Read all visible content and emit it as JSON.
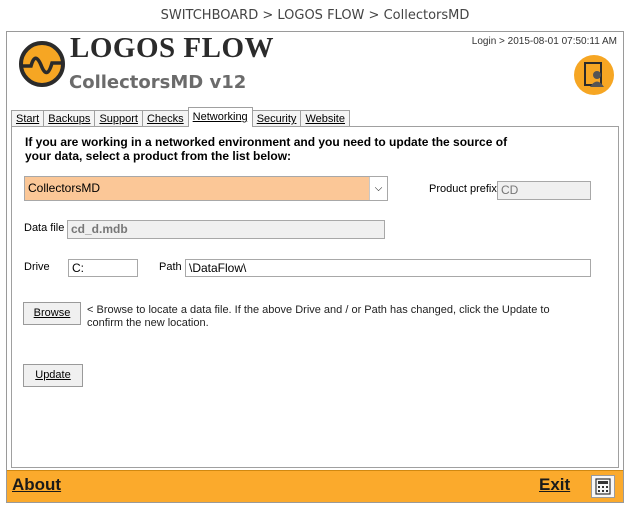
{
  "window": {
    "title": "SWITCHBOARD > LOGOS FLOW > CollectorsMD"
  },
  "header": {
    "app_name": "LOGOS FLOW",
    "subtitle": "CollectorsMD v12",
    "login": "Login > 2015-08-01 07:50:11 AM"
  },
  "tabs": [
    {
      "label": "Start",
      "active": false
    },
    {
      "label": "Backups",
      "active": false
    },
    {
      "label": "Support",
      "active": false
    },
    {
      "label": "Checks",
      "active": false
    },
    {
      "label": "Networking",
      "active": true
    },
    {
      "label": "Security",
      "active": false
    },
    {
      "label": "Website",
      "active": false
    }
  ],
  "networking": {
    "intro": "If you are working in a networked environment and you need to update the source of your data, select a product from the list below:",
    "product_select": "CollectorsMD",
    "product_prefix_label": "Product prefix",
    "product_prefix_value": "CD",
    "data_file_label": "Data file",
    "data_file_value": "cd_d.mdb",
    "drive_label": "Drive",
    "drive_value": "C:",
    "path_label": "Path",
    "path_value": "\\DataFlow\\",
    "browse_button": "Browse",
    "browse_help": "< Browse to locate a data file. If the above Drive and / or Path has changed, click the Update to confirm the new location.",
    "update_button": "Update"
  },
  "footer": {
    "about": "About",
    "exit": "Exit"
  },
  "colors": {
    "accent": "#fbaa2c",
    "select_bg": "#fbc797"
  },
  "icons": {
    "logo": "logos-flow-logo-icon",
    "user": "user-document-icon",
    "calculator": "calculator-icon"
  }
}
